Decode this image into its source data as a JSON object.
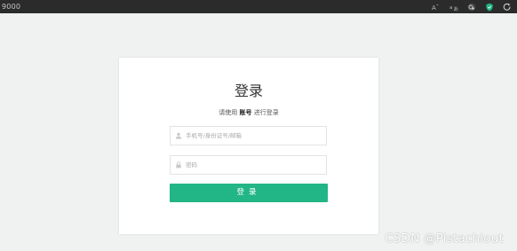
{
  "browser": {
    "url_fragment": "9000",
    "icons": [
      "read-aloud-icon",
      "translate-icon",
      "extensions-icon",
      "shield-icon",
      "refresh-icon"
    ],
    "colors": {
      "bar_bg": "#2b2b2b",
      "shield": "#22b585"
    }
  },
  "login": {
    "title": "登录",
    "subtitle": {
      "prefix": "请使用",
      "emphasis": "账号",
      "suffix": "进行登录"
    },
    "username": {
      "placeholder": "手机号/身份证号/邮箱",
      "value": ""
    },
    "password": {
      "placeholder": "密码",
      "value": ""
    },
    "submit_label": "登录",
    "colors": {
      "accent": "#22b585",
      "background": "#f0f2f1"
    }
  },
  "watermark": {
    "text": "CSDN @Pistachiout"
  }
}
